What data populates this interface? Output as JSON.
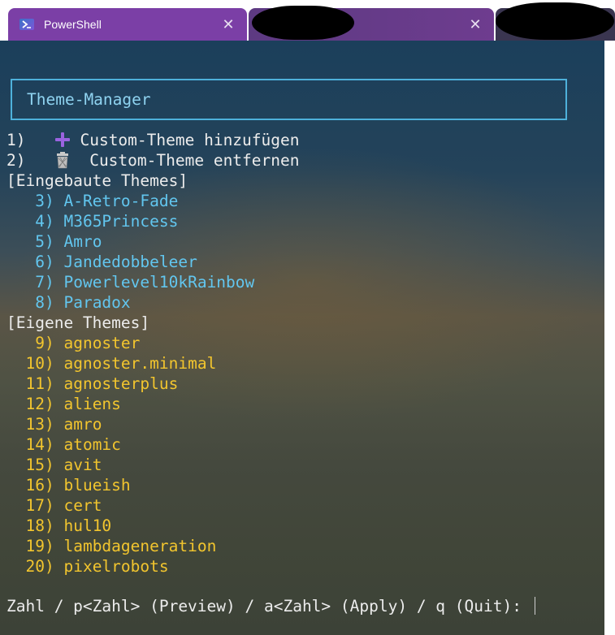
{
  "tabs": [
    {
      "title": "PowerShell",
      "close": "✕",
      "icon": "powershell-icon"
    },
    {
      "title": "",
      "close": "✕"
    },
    {
      "title": ""
    }
  ],
  "terminal": {
    "header_title": "Theme-Manager",
    "actions": [
      {
        "number": "1)",
        "icon": "plus-icon",
        "label": "Custom-Theme hinzufügen"
      },
      {
        "number": "2)",
        "icon": "trash-icon",
        "label": "Custom-Theme entfernen"
      }
    ],
    "builtin_section": "[Eingebaute Themes]",
    "builtin_themes": [
      {
        "number": "3)",
        "name": "A-Retro-Fade"
      },
      {
        "number": "4)",
        "name": "M365Princess"
      },
      {
        "number": "5)",
        "name": "Amro"
      },
      {
        "number": "6)",
        "name": "Jandedobbeleer"
      },
      {
        "number": "7)",
        "name": "Powerlevel10kRainbow"
      },
      {
        "number": "8)",
        "name": "Paradox"
      }
    ],
    "own_section": "[Eigene Themes]",
    "own_themes": [
      {
        "number": "9)",
        "name": "agnoster"
      },
      {
        "number": "10)",
        "name": "agnoster.minimal"
      },
      {
        "number": "11)",
        "name": "agnosterplus"
      },
      {
        "number": "12)",
        "name": "aliens"
      },
      {
        "number": "13)",
        "name": "amro"
      },
      {
        "number": "14)",
        "name": "atomic"
      },
      {
        "number": "15)",
        "name": "avit"
      },
      {
        "number": "16)",
        "name": "blueish"
      },
      {
        "number": "17)",
        "name": "cert"
      },
      {
        "number": "18)",
        "name": "hul10"
      },
      {
        "number": "19)",
        "name": "lambdageneration"
      },
      {
        "number": "20)",
        "name": "pixelrobots"
      }
    ],
    "prompt": "Zahl / p<Zahl> (Preview) / a<Zahl> (Apply) / q (Quit): "
  },
  "colors": {
    "tab_active": "#7b3fa6",
    "builtin_theme_text": "#62c6ef",
    "own_theme_text": "#f2c52e",
    "header_border": "#4eb1db"
  }
}
